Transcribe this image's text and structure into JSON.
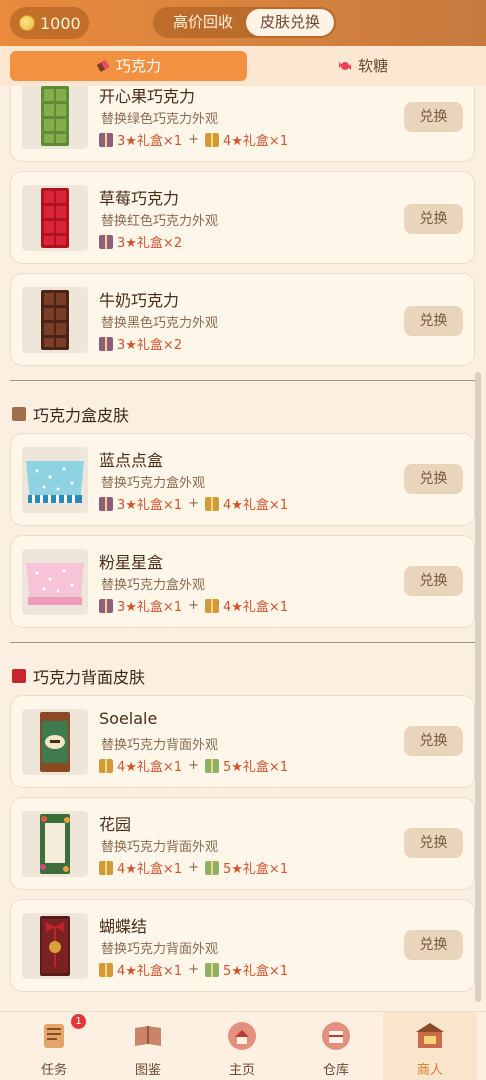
{
  "header": {
    "coins": "1000",
    "toggle": {
      "recycle": "高价回收",
      "skin": "皮肤兑换"
    }
  },
  "tabs": {
    "chocolate": "巧克力",
    "candy": "软糖"
  },
  "redeem_label": "兑换",
  "plus": "+",
  "items": [
    {
      "title": "开心果巧克力",
      "desc": "替换绿色巧克力外观",
      "cost": [
        "3★礼盒×1",
        "4★礼盒×1"
      ]
    },
    {
      "title": "草莓巧克力",
      "desc": "替换红色巧克力外观",
      "cost": [
        "3★礼盒×2"
      ]
    },
    {
      "title": "牛奶巧克力",
      "desc": "替换黑色巧克力外观",
      "cost": [
        "3★礼盒×2"
      ]
    },
    {
      "title": "蓝点点盒",
      "desc": "替换巧克力盒外观",
      "cost": [
        "3★礼盒×1",
        "4★礼盒×1"
      ]
    },
    {
      "title": "粉星星盒",
      "desc": "替换巧克力盒外观",
      "cost": [
        "3★礼盒×1",
        "4★礼盒×1"
      ]
    },
    {
      "title": "Soelale",
      "desc": "替换巧克力背面外观",
      "cost": [
        "4★礼盒×1",
        "5★礼盒×1"
      ]
    },
    {
      "title": "花园",
      "desc": "替换巧克力背面外观",
      "cost": [
        "4★礼盒×1",
        "5★礼盒×1"
      ]
    },
    {
      "title": "蝴蝶结",
      "desc": "替换巧克力背面外观",
      "cost": [
        "4★礼盒×1",
        "5★礼盒×1"
      ]
    }
  ],
  "sections": {
    "box": "巧克力盒皮肤",
    "back": "巧克力背面皮肤"
  },
  "nav": {
    "tasks": "任务",
    "tasks_badge": "1",
    "catalog": "图鉴",
    "home": "主页",
    "storage": "仓库",
    "merchant": "商人"
  },
  "colors": {
    "accent": "#f2913f",
    "cost_text": "#d2532e",
    "active_nav": "#e07a2d"
  }
}
